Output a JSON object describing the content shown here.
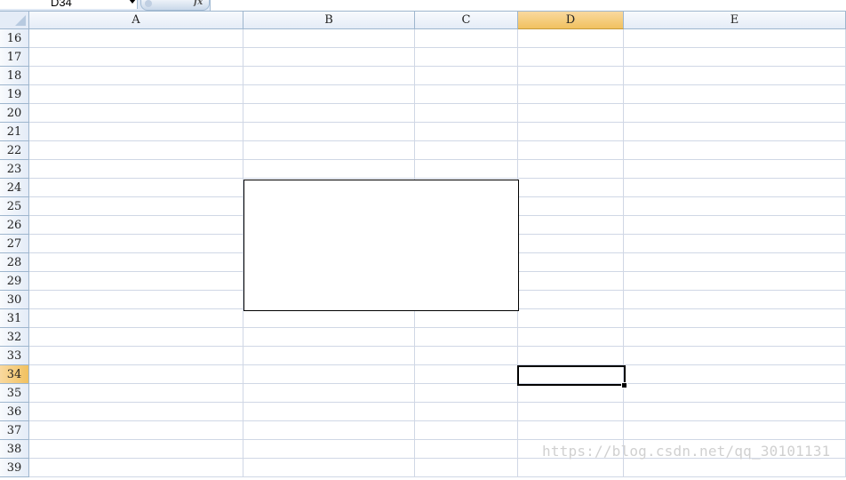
{
  "formula_bar": {
    "name_box": "D34",
    "fx_label": "fx",
    "formula": ""
  },
  "columns": [
    "A",
    "B",
    "C",
    "D",
    "E"
  ],
  "rows": [
    "16",
    "17",
    "18",
    "19",
    "20",
    "21",
    "22",
    "23",
    "24",
    "25",
    "26",
    "27",
    "28",
    "29",
    "30",
    "31",
    "32",
    "33",
    "34",
    "35",
    "36",
    "37",
    "38",
    "39"
  ],
  "selection": {
    "column": "D",
    "row": "34"
  },
  "watermark": "https://blog.csdn.net/qq_30101131",
  "colors": {
    "header_bg": "#e4ecf7",
    "selected_header": "#f1c15f",
    "gridline": "#d0d7e5"
  }
}
